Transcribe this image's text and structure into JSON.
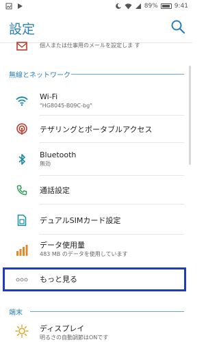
{
  "status_bar": {
    "battery": "89%",
    "time": "9:41"
  },
  "app_bar": {
    "title": "設定"
  },
  "partial_item": {
    "secondary": "個人または仕事用のメールを設定しま す"
  },
  "sections": {
    "wireless": "無線とネットワーク",
    "device": "端末"
  },
  "items": [
    {
      "primary": "Wi-Fi",
      "secondary": "\"HG8045-B09C-bg\""
    },
    {
      "primary": "テザリングとポータブルアクセス"
    },
    {
      "primary": "Bluetooth",
      "secondary": "無効"
    },
    {
      "primary": "通話設定"
    },
    {
      "primary": "デュアルSIMカード設定"
    },
    {
      "primary": "データ使用量",
      "secondary": "483 MB のデータを使用しています"
    },
    {
      "primary": "もっと見る"
    },
    {
      "primary": "ディスプレイ",
      "secondary": "明るさの自動調節はONです"
    }
  ],
  "colors": {
    "accent": "#2a7fb8",
    "highlight": "#1f3cbe",
    "icon_teal": "#1a8aa0",
    "icon_red": "#c0392b",
    "icon_orange": "#e08a2c"
  }
}
